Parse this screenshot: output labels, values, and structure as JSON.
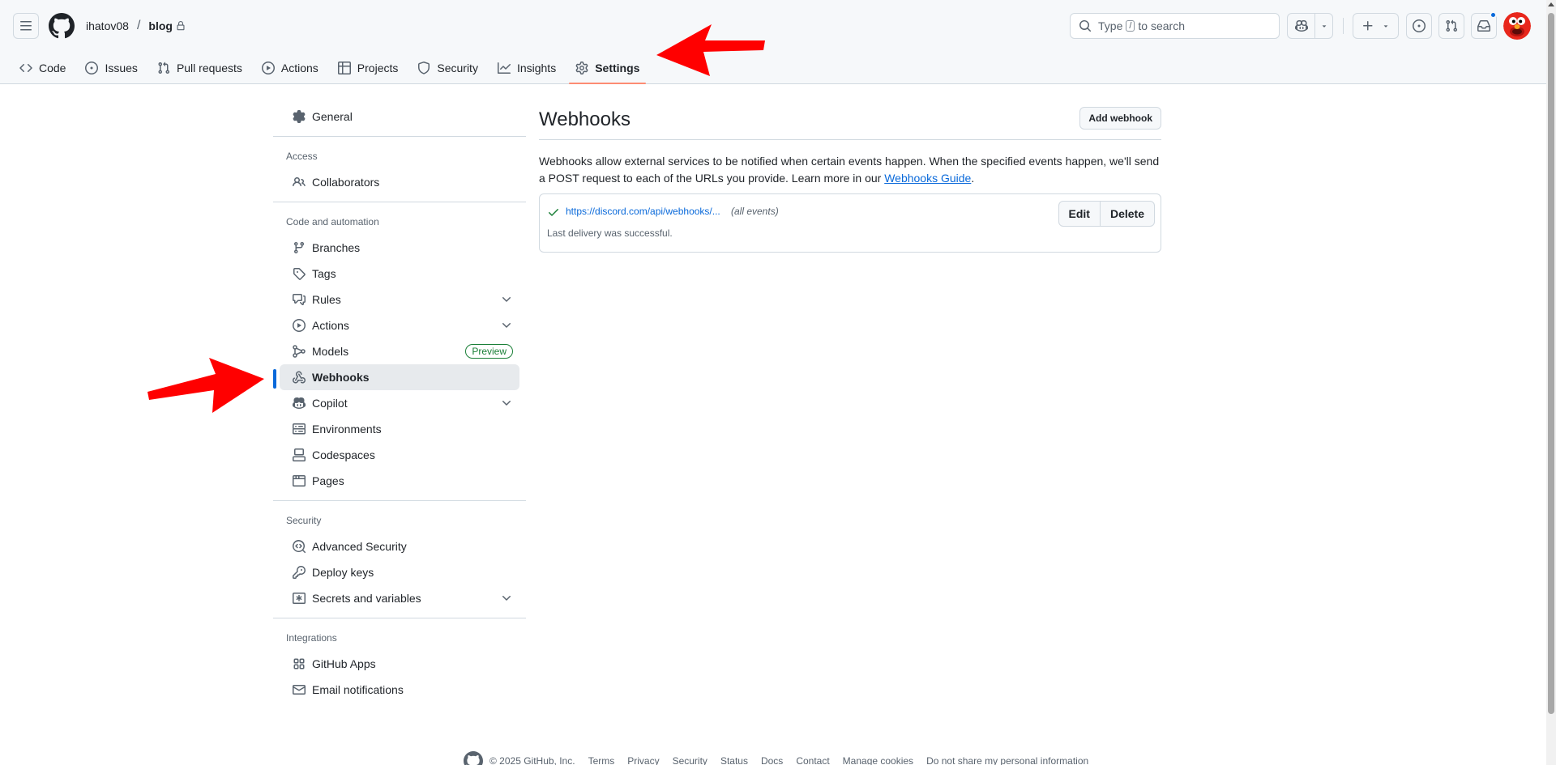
{
  "header": {
    "breadcrumb": {
      "owner": "ihatov08",
      "separator": "/",
      "repo": "blog"
    },
    "search": {
      "prefix": "Type",
      "key": "/",
      "suffix": "to search"
    }
  },
  "repo_nav": {
    "tabs": [
      {
        "label": "Code",
        "icon": "code-icon"
      },
      {
        "label": "Issues",
        "icon": "issue-opened-icon"
      },
      {
        "label": "Pull requests",
        "icon": "git-pull-request-icon"
      },
      {
        "label": "Actions",
        "icon": "play-icon"
      },
      {
        "label": "Projects",
        "icon": "table-icon"
      },
      {
        "label": "Security",
        "icon": "shield-icon"
      },
      {
        "label": "Insights",
        "icon": "graph-icon"
      },
      {
        "label": "Settings",
        "icon": "gear-icon",
        "selected": true
      }
    ]
  },
  "sidebar": {
    "general": "General",
    "groups": {
      "access": "Access",
      "code_automation": "Code and automation",
      "security": "Security",
      "integrations": "Integrations"
    },
    "items": {
      "collaborators": "Collaborators",
      "branches": "Branches",
      "tags": "Tags",
      "rules": "Rules",
      "actions": "Actions",
      "models": "Models",
      "models_badge": "Preview",
      "webhooks": "Webhooks",
      "copilot": "Copilot",
      "environments": "Environments",
      "codespaces": "Codespaces",
      "pages": "Pages",
      "advanced_security": "Advanced Security",
      "deploy_keys": "Deploy keys",
      "secrets": "Secrets and variables",
      "github_apps": "GitHub Apps",
      "email_notifications": "Email notifications"
    },
    "active": "webhooks"
  },
  "main": {
    "title": "Webhooks",
    "add_button": "Add webhook",
    "description": "Webhooks allow external services to be notified when certain events happen. When the specified events happen, we'll send a POST request to each of the URLs you provide. Learn more in our",
    "guide_link": "Webhooks Guide",
    "description_end": ".",
    "webhook": {
      "url": "https://discord.com/api/webhooks/...",
      "events": "(all events)",
      "status": "Last delivery was successful.",
      "edit": "Edit",
      "delete": "Delete"
    }
  },
  "footer": {
    "copyright": "© 2025 GitHub, Inc.",
    "links": [
      "Terms",
      "Privacy",
      "Security",
      "Status",
      "Docs",
      "Contact",
      "Manage cookies",
      "Do not share my personal information"
    ]
  },
  "colors": {
    "accent": "#0969da",
    "tab_underline": "#fd8c73",
    "annotation_arrow": "#ff0000",
    "success": "#1a7f37"
  }
}
